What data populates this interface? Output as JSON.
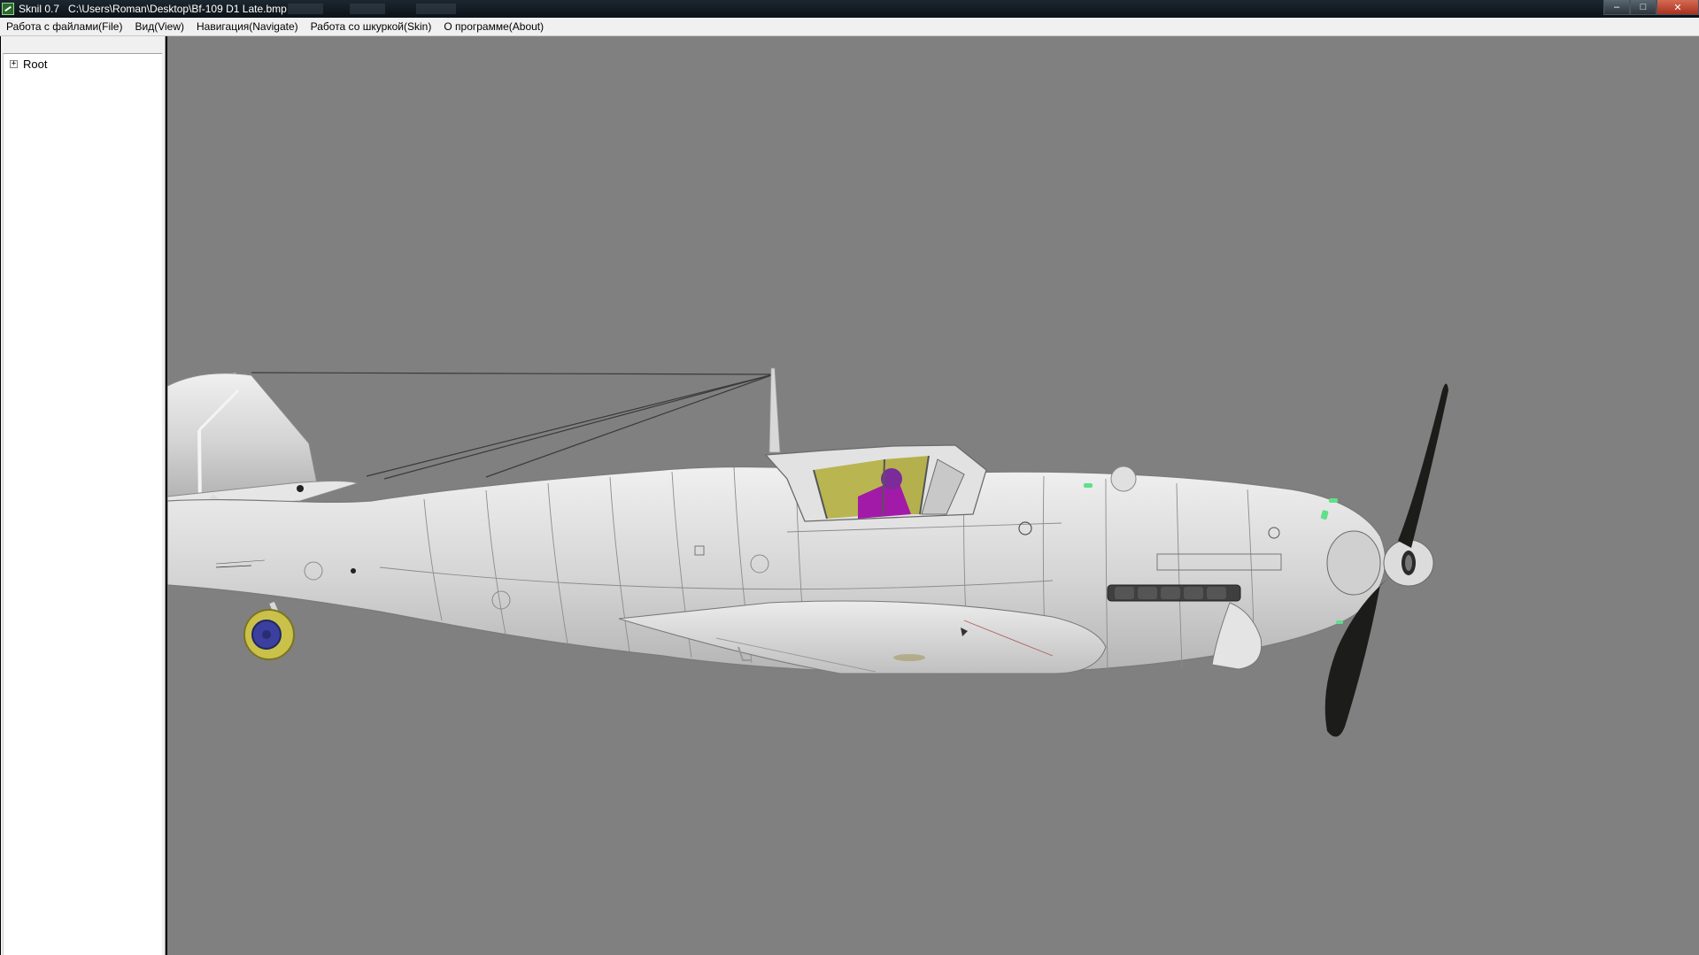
{
  "window": {
    "app_name": "Sknil 0.7",
    "file_path": "C:\\Users\\Roman\\Desktop\\Bf-109 D1 Late.bmp",
    "controls": {
      "minimize": "–",
      "maximize": "□",
      "close": "✕"
    }
  },
  "menu": {
    "items": [
      "Работа с файлами(File)",
      "Вид(View)",
      "Навигация(Navigate)",
      "Работа со шкуркой(Skin)",
      "О программе(About)"
    ]
  },
  "tree": {
    "root_label": "Root",
    "expander": "+"
  },
  "viewport": {
    "background": "#808080",
    "fuselage_color": "#d9d9d9",
    "wheel_color": "#c9c14a",
    "hub_color": "#3b3fa0",
    "propeller_color": "#1c1c1a",
    "canopy_color": "#b5b040",
    "pilot_color": "#a21aa8",
    "marker_color": "#5fe08a",
    "icons": [
      "airplane-model-3d"
    ]
  }
}
